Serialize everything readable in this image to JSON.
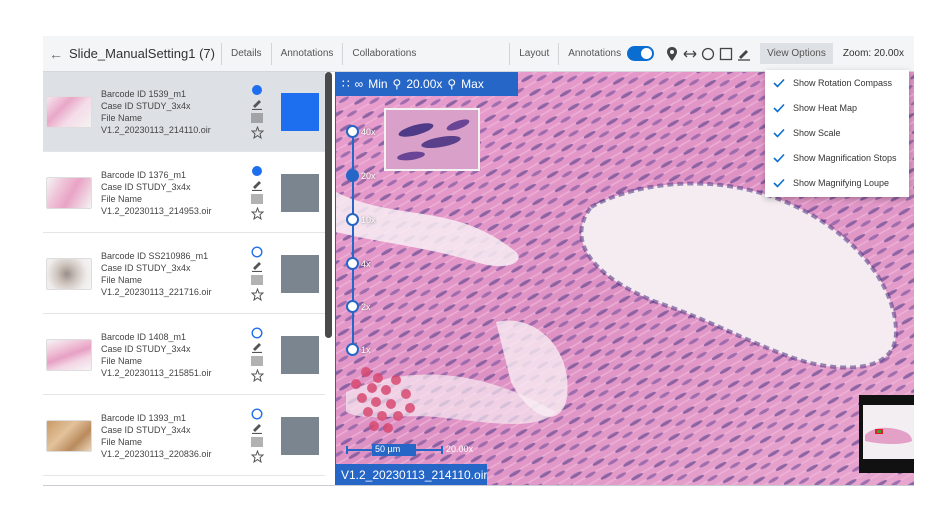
{
  "header": {
    "back_icon": "arrow-left-icon",
    "title": "Slide_ManualSetting1 (7)",
    "tabs": [
      "Details",
      "Annotations",
      "Collaborations"
    ],
    "layout_label": "Layout",
    "annotations_label": "Annotations",
    "annotations_on": true,
    "tools": [
      "pin-icon",
      "measure-icon",
      "circle-icon",
      "rectangle-icon",
      "pen-icon"
    ],
    "view_options_label": "View Options",
    "zoom_label": "Zoom: 20.00x"
  },
  "slides": [
    {
      "barcode": "Barcode ID 1539_m1",
      "case": "Case ID STUDY_3x4x",
      "file_label": "File Name",
      "file": "V1.2_20230113_214110.oir",
      "status": "filled",
      "color": "#1e6ff0",
      "selected": true
    },
    {
      "barcode": "Barcode ID 1376_m1",
      "case": "Case ID STUDY_3x4x",
      "file_label": "File Name",
      "file": "V1.2_20230113_214953.oir",
      "status": "filled",
      "color": "#7b858f",
      "selected": false
    },
    {
      "barcode": "Barcode ID SS210986_m1",
      "case": "Case ID STUDY_3x4x",
      "file_label": "File Name",
      "file": "V1.2_20230113_221716.oir",
      "status": "open",
      "color": "#7b858f",
      "selected": false
    },
    {
      "barcode": "Barcode ID 1408_m1",
      "case": "Case ID STUDY_3x4x",
      "file_label": "File Name",
      "file": "V1.2_20230113_215851.oir",
      "status": "open",
      "color": "#7b858f",
      "selected": false
    },
    {
      "barcode": "Barcode ID 1393_m1",
      "case": "Case ID STUDY_3x4x",
      "file_label": "File Name",
      "file": "V1.2_20230113_220836.oir",
      "status": "open",
      "color": "#7b858f",
      "selected": false
    }
  ],
  "viewer": {
    "min_label": "Min",
    "zoom_value": "20.00x",
    "max_label": "Max",
    "stops": [
      "40x",
      "20x",
      "10x",
      "4x",
      "2x",
      "1x"
    ],
    "current_stop": "20x",
    "scale_label": "50 µm",
    "scale_zoom": "20.00x",
    "filename": "V1.2_20230113_214110.oir"
  },
  "view_options_menu": [
    {
      "label": "Show Rotation Compass",
      "checked": true
    },
    {
      "label": "Show Heat Map",
      "checked": true
    },
    {
      "label": "Show Scale",
      "checked": true
    },
    {
      "label": "Show Magnification Stops",
      "checked": true
    },
    {
      "label": "Show Magnifying Loupe",
      "checked": true
    }
  ],
  "colors": {
    "accent": "#2566c7",
    "toggle": "#0a6ed1",
    "tissue_pink": "#e7a0c8",
    "nuclei": "#5a3f8a"
  }
}
